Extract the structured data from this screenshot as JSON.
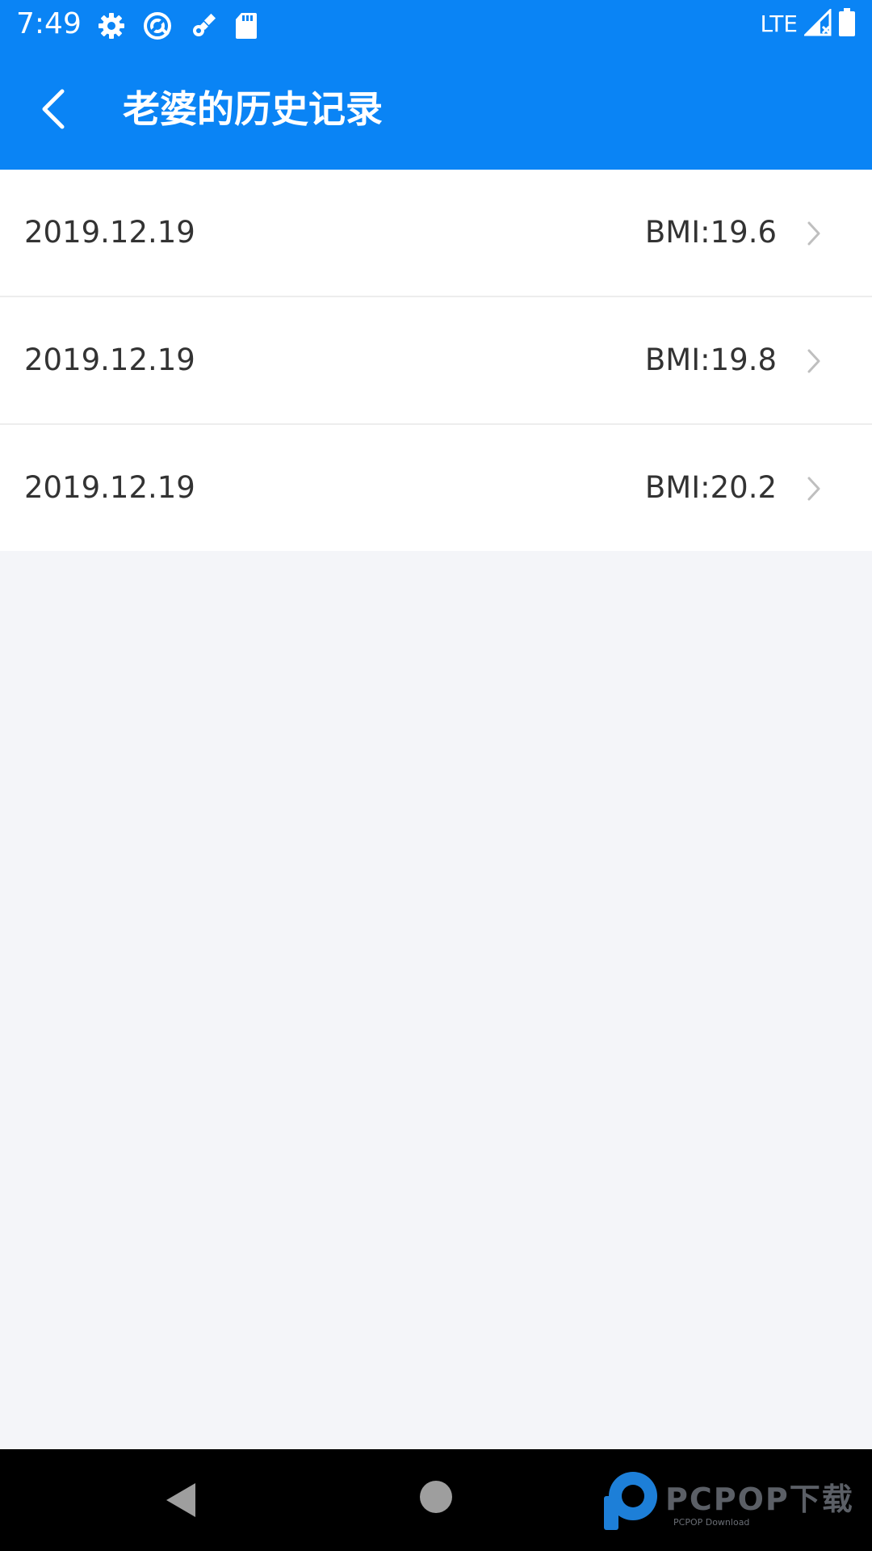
{
  "status_bar": {
    "time": "7:49",
    "network": "LTE",
    "icons": [
      "settings-icon",
      "sync-icon",
      "satellite-icon",
      "sd-card-icon",
      "signal-icon",
      "battery-icon"
    ]
  },
  "app_bar": {
    "title": "老婆的历史记录",
    "back_icon": "chevron-left-icon"
  },
  "records": [
    {
      "date": "2019.12.19",
      "bmi": "BMI:19.6"
    },
    {
      "date": "2019.12.19",
      "bmi": "BMI:19.8"
    },
    {
      "date": "2019.12.19",
      "bmi": "BMI:20.2"
    }
  ],
  "navigation": {
    "icons": [
      "back-triangle-icon",
      "home-circle-icon"
    ]
  },
  "watermark": {
    "text": "PCPOP下载",
    "subtext": "PCPOP Download"
  },
  "colors": {
    "primary": "#0a84f5",
    "background": "#f4f5f9",
    "row_text": "#333333",
    "divider": "#ededed"
  }
}
